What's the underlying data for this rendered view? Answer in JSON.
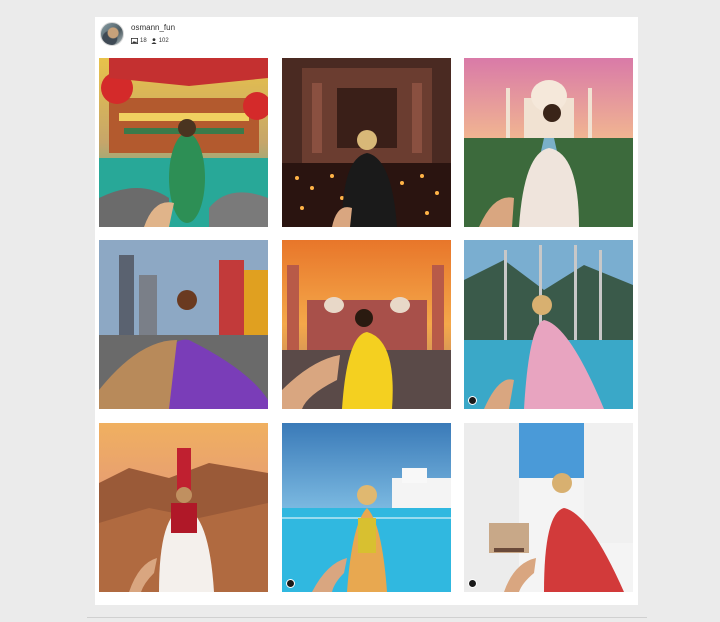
{
  "profile": {
    "username": "osmann_fun",
    "media_count": "18",
    "follower_count": "102"
  },
  "posts": [
    {
      "scene": "neon-boat-harbor",
      "icon": "none"
    },
    {
      "scene": "stone-temple-candles",
      "icon": "none"
    },
    {
      "scene": "white-domed-mausoleum",
      "icon": "none"
    },
    {
      "scene": "city-square-purple-dress",
      "icon": "none"
    },
    {
      "scene": "mosque-sunset-yellow-dress",
      "icon": "none"
    },
    {
      "scene": "mountain-lake-pink-dress",
      "icon": "user-icon"
    },
    {
      "scene": "canyon-red-outfit",
      "icon": "none"
    },
    {
      "scene": "blue-pool-white-houses",
      "icon": "user-icon"
    },
    {
      "scene": "whitewashed-street-red-dress",
      "icon": "user-icon"
    }
  ],
  "colors": {
    "page_background": "#ebebeb",
    "card_background": "#ffffff",
    "text": "#333333"
  }
}
